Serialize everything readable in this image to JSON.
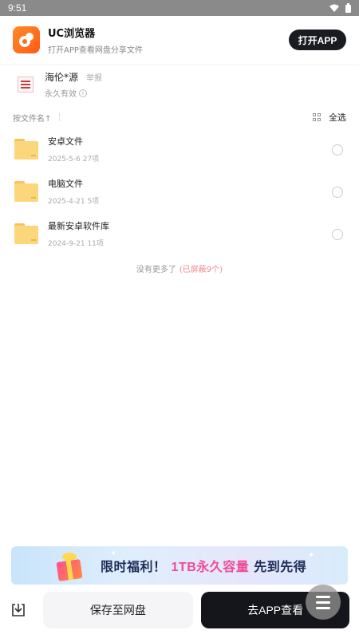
{
  "status_bar": {
    "time": "9:51"
  },
  "app_banner": {
    "app_name": "UC浏览器",
    "subtitle": "打开APP查看网盘分享文件",
    "open_button": "打开APP"
  },
  "owner": {
    "name": "海伦*源",
    "report": "举报",
    "validity": "永久有效",
    "info_glyph": "i"
  },
  "sort_bar": {
    "sort_label": "按文件名↑",
    "select_all": "全选"
  },
  "files": [
    {
      "name": "安卓文件",
      "date": "2025-5-6",
      "count": "27项"
    },
    {
      "name": "电脑文件",
      "date": "2025-4-21",
      "count": "5项"
    },
    {
      "name": "最新安卓软件库",
      "date": "2024-9-21",
      "count": "11项"
    }
  ],
  "footer_note": {
    "text": "没有更多了",
    "blocked": "(已屏蔽9个)"
  },
  "promo": {
    "prefix": "限时福利！",
    "highlight": "1TB永久容量",
    "suffix": "先到先得"
  },
  "bottom_bar": {
    "save_button": "保存至网盘",
    "go_app_button": "去APP查看"
  },
  "colors": {
    "status_bar": "#8a8a8a",
    "dark_button": "#1b1c22",
    "folder": "#fcd67a",
    "promo_highlight": "#f04a9a"
  }
}
